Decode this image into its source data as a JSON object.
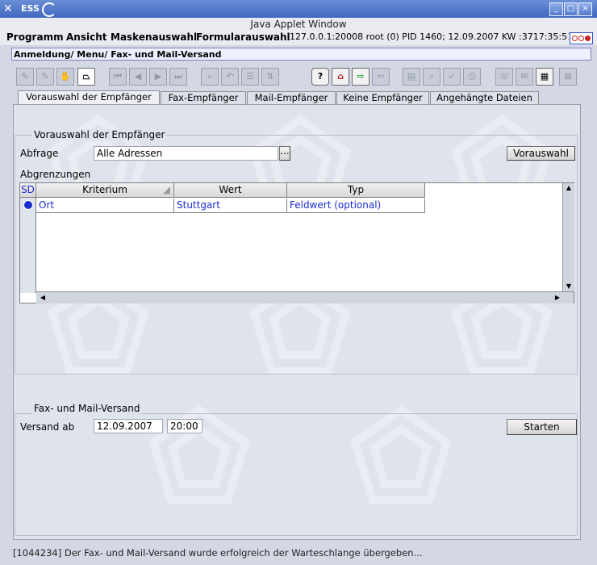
{
  "window": {
    "app_name": "ESS",
    "applet_caption": "Java Applet Window",
    "minimize_glyph": "_",
    "maximize_glyph": "□",
    "close_glyph": "×"
  },
  "menubar": {
    "items": [
      "Programm",
      "Ansicht",
      "Maskenauswahl",
      "Formularauswahl"
    ],
    "status_info": "127.0.0.1:20008 root (0) PID 1460; 12.09.2007 KW :3717:35:51"
  },
  "breadcrumb": "Anmeldung/ Menu/ Fax- und Mail-Versand",
  "toolbar": {
    "help_glyph": "?"
  },
  "tabs": [
    {
      "label": "Vorauswahl der Empfänger",
      "selected": true
    },
    {
      "label": "Fax-Empfänger",
      "selected": false
    },
    {
      "label": "Mail-Empfänger",
      "selected": false
    },
    {
      "label": "Keine Empfänger",
      "selected": false
    },
    {
      "label": "Angehängte Dateien",
      "selected": false
    }
  ],
  "preselect": {
    "group_title": "Vorauswahl der Empfänger",
    "query_label": "Abfrage",
    "query_value": "Alle Adressen",
    "browse_glyph": "...",
    "preselect_button": "Vorauswahl",
    "limits_label": "Abgrenzungen"
  },
  "table": {
    "columns": [
      "SD",
      "Kriterium",
      "Wert",
      "Typ"
    ],
    "rows": [
      {
        "criterion": "Ort",
        "value": "Stuttgart",
        "type": "Feldwert (optional)"
      }
    ]
  },
  "dispatch": {
    "group_title": "Fax- und Mail-Versand",
    "send_from_label": "Versand ab",
    "date_value": "12.09.2007",
    "time_value": "20:00",
    "start_button": "Starten"
  },
  "status_message": "[1044234] Der Fax- und Mail-Versand wurde erfolgreich der Warteschlange übergeben...",
  "colors": {
    "titlebar": "#3f68c0",
    "link_text": "#1a2ed0",
    "panel_bg": "#dfe3ec"
  }
}
